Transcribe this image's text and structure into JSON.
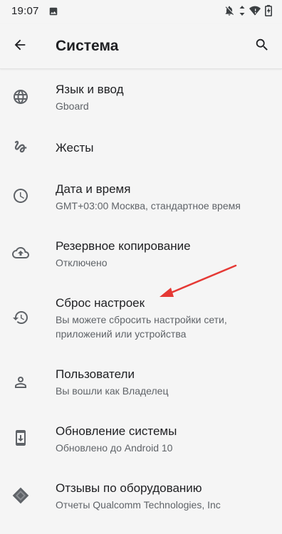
{
  "status_bar": {
    "time": "19:07",
    "icons": [
      "image-icon",
      "bell-off-icon",
      "data-arrows-icon",
      "wifi-icon",
      "battery-charging-icon"
    ]
  },
  "app_bar": {
    "title": "Система",
    "back_icon": "arrow-back-icon",
    "search_icon": "search-icon"
  },
  "settings": [
    {
      "title": "Язык и ввод",
      "subtitle": "Gboard",
      "icon": "globe-icon"
    },
    {
      "title": "Жесты",
      "subtitle": "",
      "icon": "gesture-icon"
    },
    {
      "title": "Дата и время",
      "subtitle": "GMT+03:00 Москва, стандартное время",
      "icon": "clock-icon"
    },
    {
      "title": "Резервное копирование",
      "subtitle": "Отключено",
      "icon": "cloud-upload-icon"
    },
    {
      "title": "Сброс настроек",
      "subtitle": "Вы можете сбросить настройки сети, приложений или устройства",
      "icon": "history-icon"
    },
    {
      "title": "Пользователи",
      "subtitle": "Вы вошли как Владелец",
      "icon": "person-icon"
    },
    {
      "title": "Обновление системы",
      "subtitle": "Обновлено до Android 10",
      "icon": "system-update-icon"
    },
    {
      "title": "Отзывы по оборудованию",
      "subtitle": "Отчеты Qualcomm Technologies, Inc",
      "icon": "chip-icon"
    }
  ],
  "annotation": {
    "color": "#e53935",
    "points_to": "Сброс настроек"
  }
}
